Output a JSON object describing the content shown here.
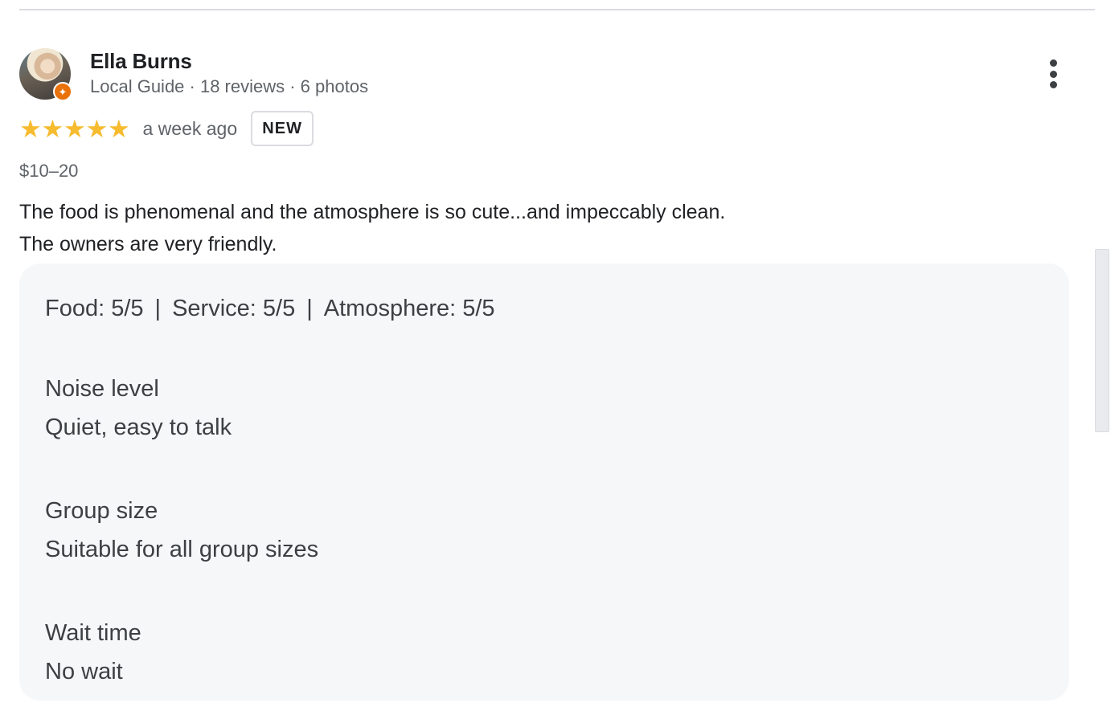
{
  "reviewer": {
    "name": "Ella Burns",
    "meta": "Local Guide · 18 reviews · 6 photos",
    "badge_icon": "local-guide-star"
  },
  "rating": {
    "stars": 5,
    "star_glyph": "★",
    "star_color": "#f6bb2f",
    "time": "a week ago",
    "badge": "NEW"
  },
  "price": "$10–20",
  "text": {
    "line1": "The food is phenomenal and the atmosphere is so cute...and impeccably clean.",
    "line2": "The owners are very friendly."
  },
  "details": {
    "food": "Food: 5/5",
    "service": "Service: 5/5",
    "atmosphere": "Atmosphere: 5/5",
    "separator": "|",
    "groups": [
      {
        "title": "Noise level",
        "value": "Quiet, easy to talk"
      },
      {
        "title": "Group size",
        "value": "Suitable for all group sizes"
      },
      {
        "title": "Wait time",
        "value": "No wait"
      }
    ]
  },
  "icons": {
    "more": "more-vert-icon",
    "badge": "✦"
  }
}
